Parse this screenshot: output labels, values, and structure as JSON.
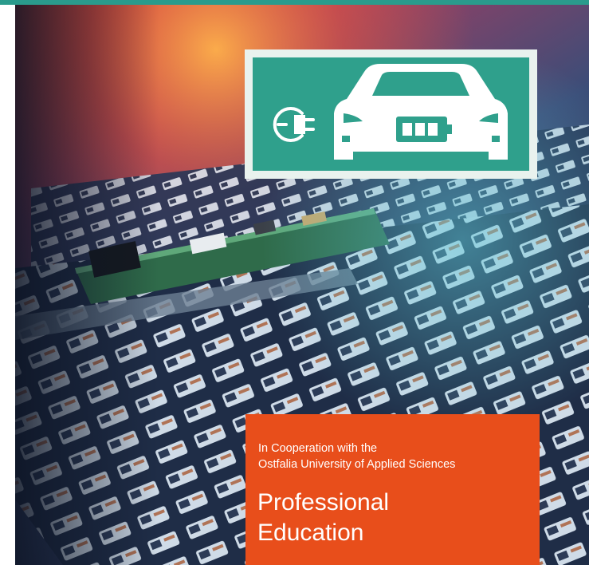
{
  "brand": {
    "accent_teal": "#2fa08c",
    "accent_orange": "#e84e1b",
    "photo_subject": "battery-cell-module-with-circuit-board",
    "icons": [
      "plug-icon",
      "electric-car-icon",
      "battery-icon"
    ]
  },
  "cooperation": {
    "line1": "In Cooperation with the",
    "line2": "Ostfalia University of Applied Sciences"
  },
  "title": {
    "line1": "Professional",
    "line2": "Education"
  }
}
